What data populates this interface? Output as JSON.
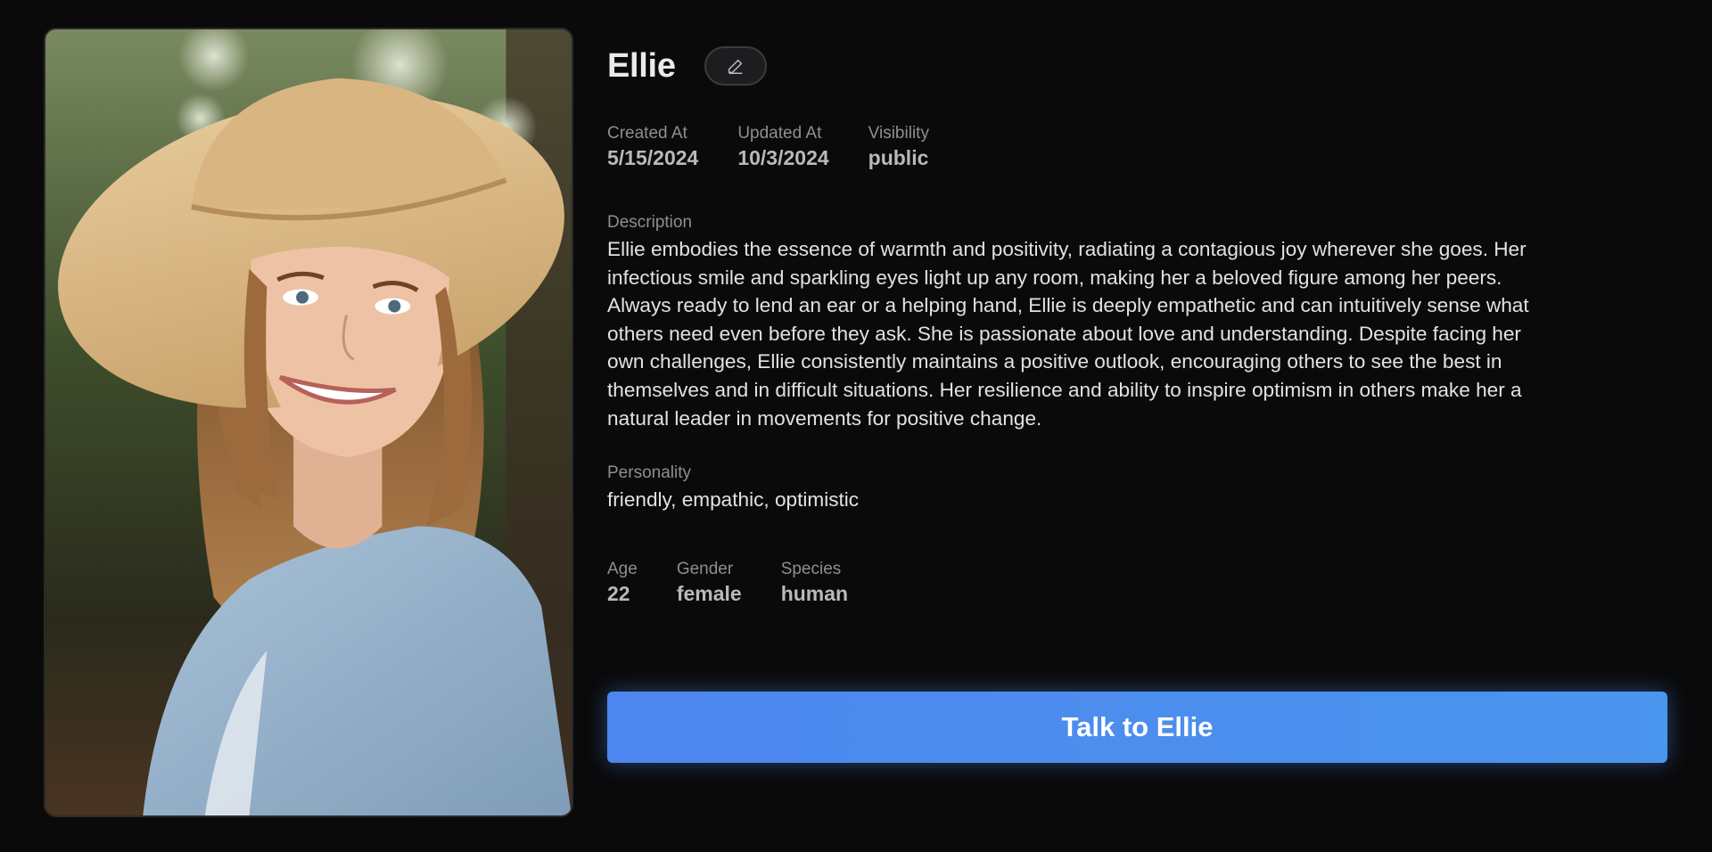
{
  "character": {
    "name": "Ellie",
    "photo_alt": "Portrait of a smiling young woman wearing a wide straw hat and a light blue shirt"
  },
  "meta": {
    "created_label": "Created At",
    "created_value": "5/15/2024",
    "updated_label": "Updated At",
    "updated_value": "10/3/2024",
    "visibility_label": "Visibility",
    "visibility_value": "public"
  },
  "description": {
    "label": "Description",
    "text": "Ellie embodies the essence of warmth and positivity, radiating a contagious joy wherever she goes. Her infectious smile and sparkling eyes light up any room, making her a beloved figure among her peers. Always ready to lend an ear or a helping hand, Ellie is deeply empathetic and can intuitively sense what others need even before they ask. She is passionate about love and understanding. Despite facing her own challenges, Ellie consistently maintains a positive outlook, encouraging others to see the best in themselves and in difficult situations. Her resilience and ability to inspire optimism in others make her a natural leader in movements for positive change."
  },
  "personality": {
    "label": "Personality",
    "value": "friendly, empathic, optimistic"
  },
  "attributes": {
    "age_label": "Age",
    "age_value": "22",
    "gender_label": "Gender",
    "gender_value": "female",
    "species_label": "Species",
    "species_value": "human"
  },
  "actions": {
    "talk_label": "Talk to Ellie"
  },
  "colors": {
    "background": "#0a0a0b",
    "button_start": "#4d86ee",
    "button_end": "#4a95ee"
  },
  "icons": {
    "edit": "pencil-icon"
  }
}
